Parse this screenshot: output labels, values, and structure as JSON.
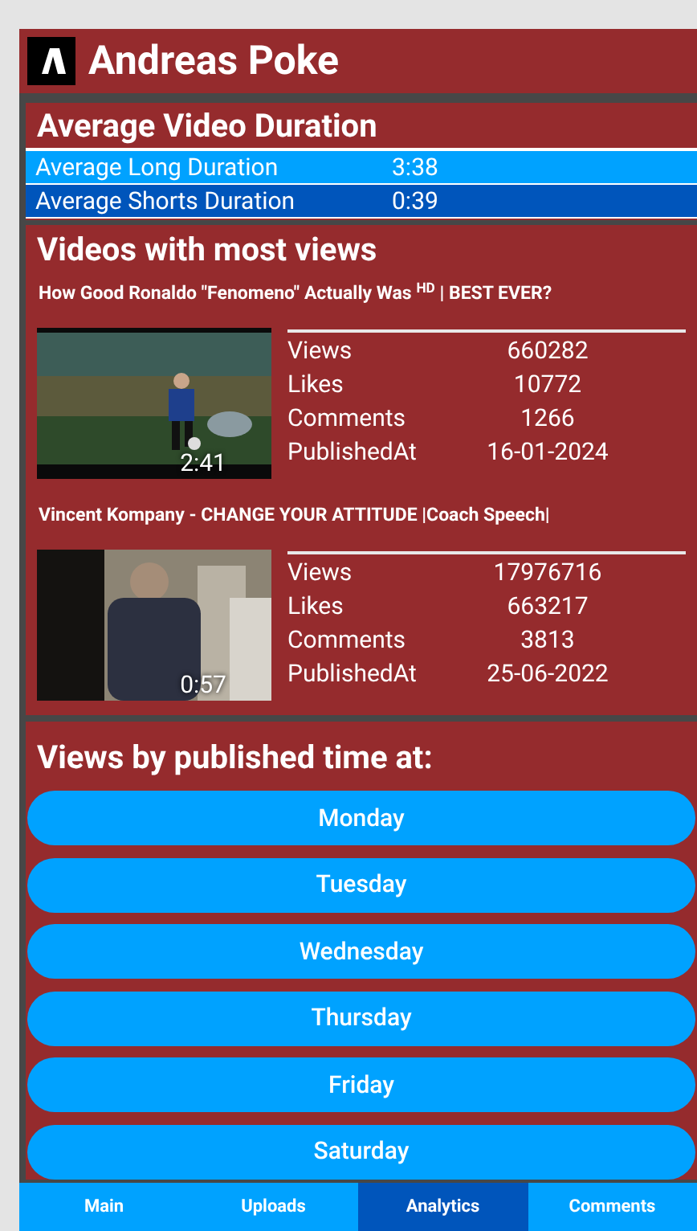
{
  "header": {
    "title": "Andreas Poke"
  },
  "average_duration": {
    "title": "Average Video Duration",
    "rows": [
      {
        "label": "Average Long Duration",
        "value": "3:38",
        "color": "#00a2ff"
      },
      {
        "label": "Average Shorts Duration",
        "value": "0:39",
        "color": "#0055bb"
      }
    ]
  },
  "top_videos": {
    "title": "Videos with most views",
    "videos": [
      {
        "title": "How Good Ronaldo \"Fenomeno\" Actually Was $^{HD}$ | BEST EVER?",
        "duration": "2:41",
        "stats": [
          {
            "label": "Views",
            "value": "660282"
          },
          {
            "label": "Likes",
            "value": "10772"
          },
          {
            "label": "Comments",
            "value": "1266"
          },
          {
            "label": "PublishedAt",
            "value": "16-01-2024"
          }
        ]
      },
      {
        "title": "Vincent Kompany - CHANGE YOUR ATTITUDE |Coach Speech|",
        "duration": "0:57",
        "stats": [
          {
            "label": "Views",
            "value": "17976716"
          },
          {
            "label": "Likes",
            "value": "663217"
          },
          {
            "label": "Comments",
            "value": "3813"
          },
          {
            "label": "PublishedAt",
            "value": "25-06-2022"
          }
        ]
      }
    ]
  },
  "views_by_time": {
    "title": "Views by published time at:",
    "days": [
      "Monday",
      "Tuesday",
      "Wednesday",
      "Thursday",
      "Friday",
      "Saturday"
    ]
  },
  "tabs": [
    {
      "label": "Main",
      "selected": false
    },
    {
      "label": "Uploads",
      "selected": false
    },
    {
      "label": "Analytics",
      "selected": true
    },
    {
      "label": "Comments",
      "selected": false
    }
  ]
}
